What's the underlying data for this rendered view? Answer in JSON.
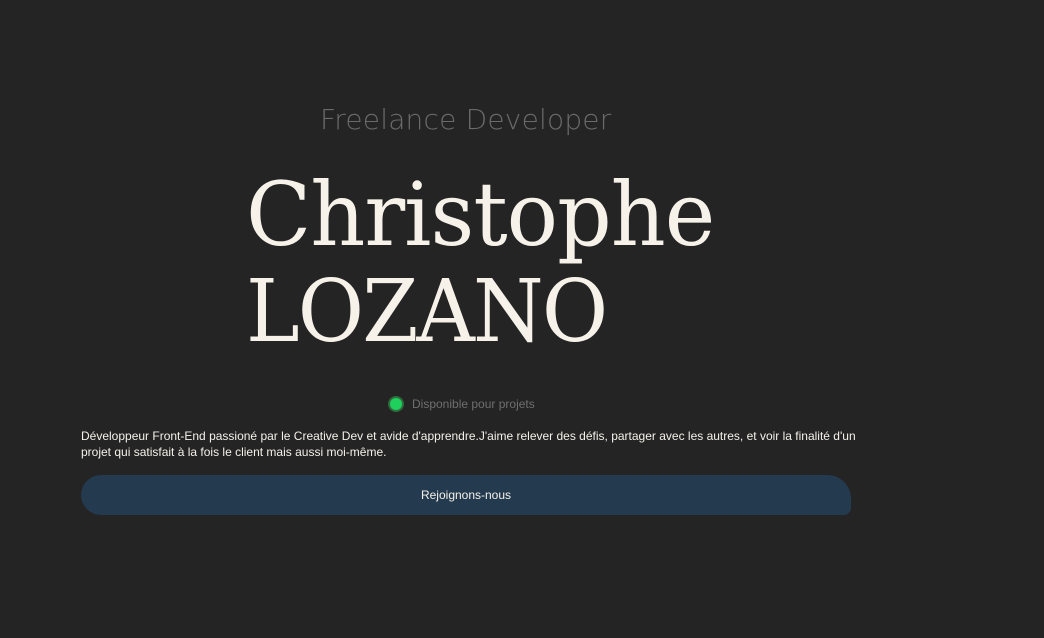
{
  "hero": {
    "subtitle": "Freelance Developer",
    "first_name": "Christophe",
    "last_name": "LOZANO",
    "availability": {
      "text": "Disponible pour projets",
      "status_color": "#1fd15c"
    },
    "description": "Développeur Front-End passioné par le Creative Dev et avide d'apprendre.J'aime relever des défis, partager avec les autres, et voir la finalité d'un projet qui satisfait à la fois le client mais aussi moi-même.",
    "cta_label": "Rejoignons-nous"
  },
  "colors": {
    "background": "#252424",
    "button": "#243a4f",
    "text": "#f4f1ea",
    "muted": "#6a6a6a"
  }
}
